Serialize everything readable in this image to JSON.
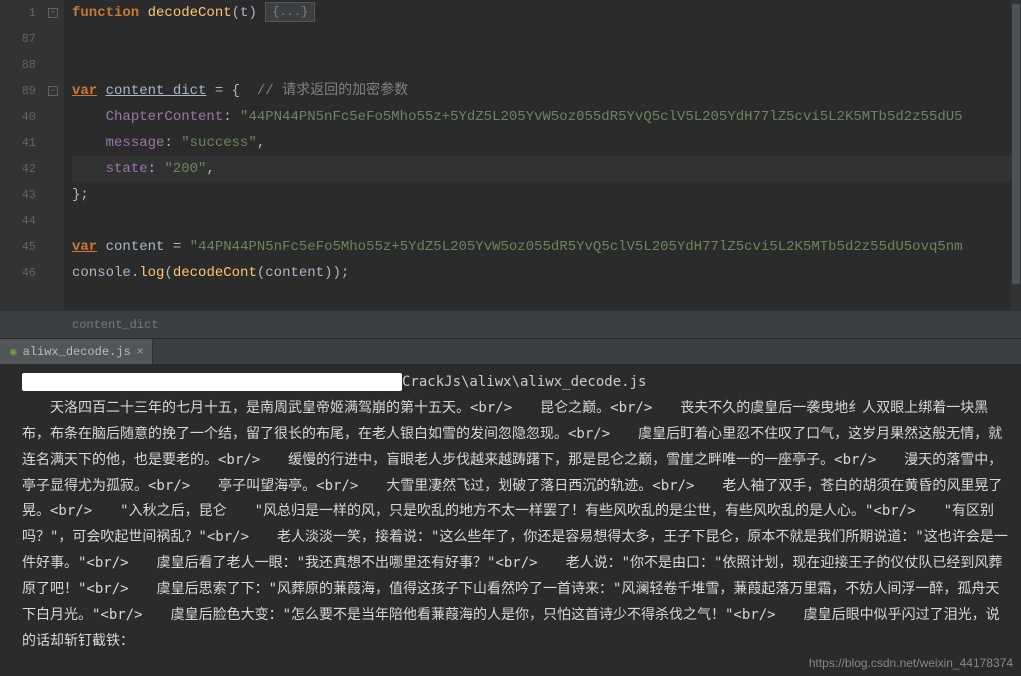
{
  "editor": {
    "line_numbers": [
      "1",
      "87",
      "88",
      "89",
      "40",
      "41",
      "42",
      "43",
      "44",
      "45",
      "46"
    ],
    "fold_markers": {
      "0": "+",
      "3": "−",
      "8": ""
    },
    "lines": {
      "fn_kw": "function",
      "fn_name": "decodeCont",
      "fn_params": "(t) ",
      "fn_fold": "{...}",
      "var_kw": "var",
      "cd_name": "content_dict",
      "cd_assign": " = {  ",
      "cd_comment": "// 请求返回的加密参数",
      "cc_key": "ChapterContent",
      "cc_colon": ": ",
      "cc_val": "\"44PN44PN5nFc5eFo5Mho55z+5YdZ5L205YvW5oz055dR5YvQ5clV5L205YdH77lZ5cvi5L2K5MTb5d2z55dU5",
      "msg_key": "message",
      "msg_val": "\"success\"",
      "st_key": "state",
      "st_val": "\"200\"",
      "comma": ",",
      "close_obj": "};",
      "ct_name": "content",
      "ct_assign": " = ",
      "ct_val": "\"44PN44PN5nFc5eFo5Mho55z+5YdZ5L205YvW5oz055dR5YvQ5clV5L205YdH77lZ5cvi5L2K5MTb5d2z55dU5ovq5nm",
      "cons": "console",
      "dot": ".",
      "log": "log",
      "lp": "(",
      "rp": ")",
      "call_arg": "content",
      "semi": ";"
    },
    "breadcrumb": "content_dict"
  },
  "tabs": {
    "file": "aliwx_decode.js",
    "close": "×"
  },
  "console": {
    "path": "CrackJs\\aliwx\\aliwx_decode.js",
    "output": "　　天洛四百二十三年的七月十五，是南周武皇帝姬满驾崩的第十五天。<br/>　　昆仑之巅。<br/>　　丧夫不久的虞皇后一袭曳地纟人双眼上绑着一块黑布，布条在脑后随意的挽了一个结，留了很长的布尾，在老人银白如雪的发间忽隐忽现。<br/>　　虞皇后盯着心里忍不住叹了口气，这岁月果然这般无情，就连名满天下的他，也是要老的。<br/>　　缓慢的行进中，盲眼老人步伐越来越踌躇下，那是昆仑之巅，雪崖之畔唯一的一座亭子。<br/>　　漫天的落雪中，亭子显得尤为孤寂。<br/>　　亭子叫望海亭。<br/>　　大雪里凄然飞过，划破了落日西沉的轨迹。<br/>　　老人袖了双手，苍白的胡须在黄昏的风里晃了晃。<br/>　　\"入秋之后，昆仑　　\"风总归是一样的风，只是吹乱的地方不太一样罢了！有些风吹乱的是尘世，有些风吹乱的是人心。\"<br/>　　\"有区别吗？\"，可会吹起世间祸乱？\"<br/>　　老人淡淡一笑，接着说：\"这么些年了，你还是容易想得太多，王子下昆仑，原本不就是我们所期说道：\"这也许会是一件好事。\"<br/>　　虞皇后看了老人一眼：\"我还真想不出哪里还有好事？\"<br/>　　老人说：\"你不是由口：\"依照计划，现在迎接王子的仪仗队已经到风葬原了吧！\"<br/>　　虞皇后思索了下：\"风葬原的蒹葭海，值得这孩子下山看然吟了一首诗来：\"风澜轻卷千堆雪，蒹葭起落万里霜，不妨人间浮一醉，孤舟天下白月光。\"<br/>　　虞皇后脸色大变：\"怎么要不是当年陪他看蒹葭海的人是你，只怕这首诗少不得杀伐之气！\"<br/>　　虞皇后眼中似乎闪过了泪光，说的话却斩钉截铁："
  },
  "watermark": "https://blog.csdn.net/weixin_44178374"
}
